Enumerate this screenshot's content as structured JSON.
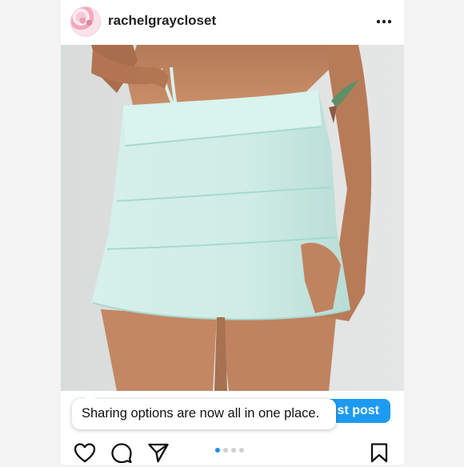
{
  "post": {
    "username": "rachelgraycloset"
  },
  "promo": {
    "label": "st post"
  },
  "toast": {
    "text": "Sharing options are now all in one place."
  },
  "carousel": {
    "count": 4,
    "active_index": 0
  },
  "icons": {
    "avatar": "profile-avatar",
    "more": "more-options-icon",
    "like": "heart-icon",
    "comment": "comment-icon",
    "share": "share-icon",
    "save": "bookmark-icon"
  },
  "colors": {
    "accent": "#1d9bf0",
    "dot_active": "#2b8de3",
    "skirt": "#cfece6"
  }
}
